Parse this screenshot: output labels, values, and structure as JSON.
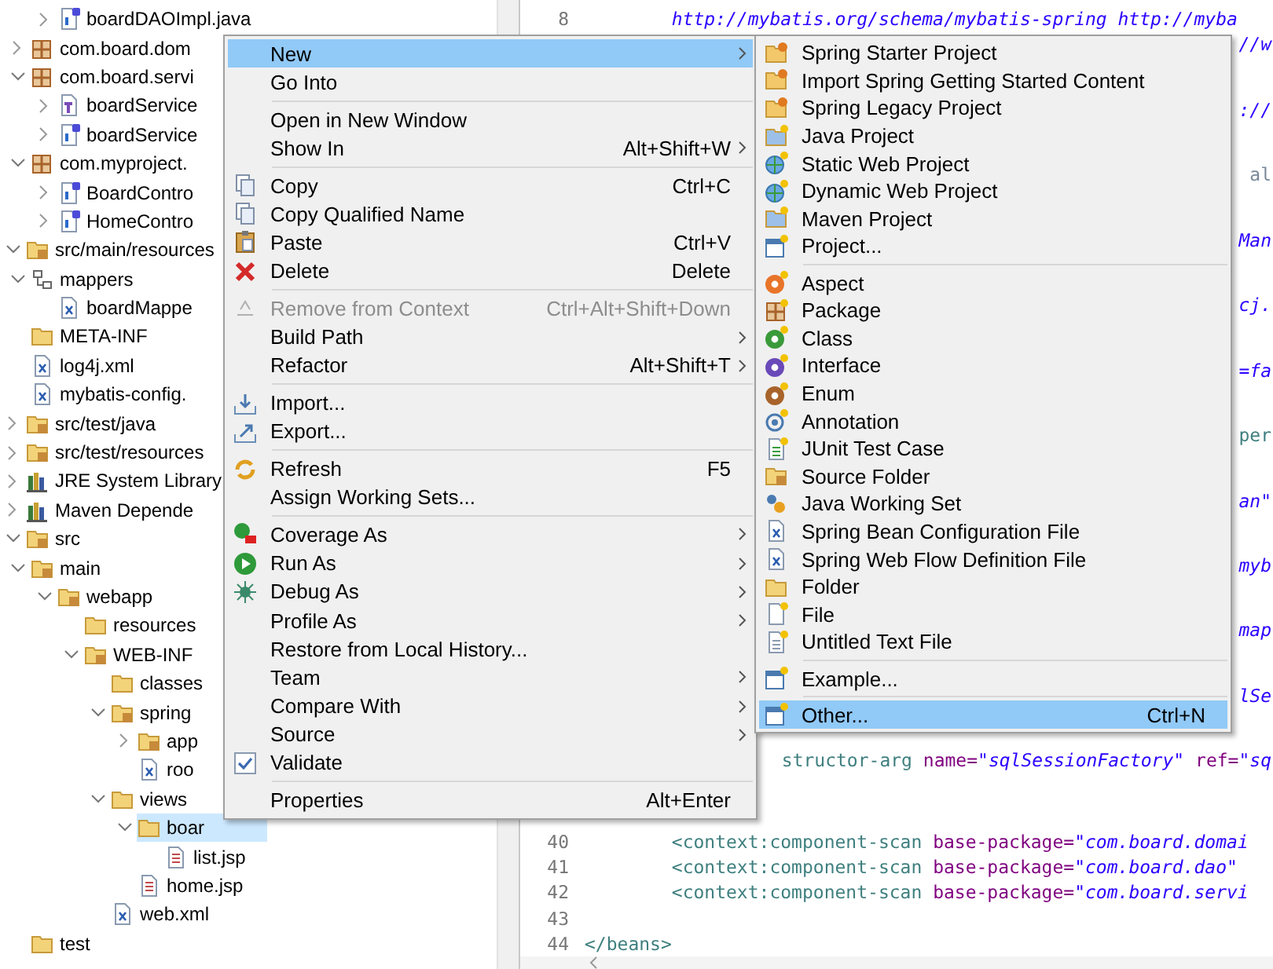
{
  "explorer": {
    "items": [
      {
        "children": [
          {
            "children": [
              {
                "label": "boardDAOImpl.java",
                "kind": "class",
                "expanded": false,
                "selected": false
              }
            ]
          },
          {
            "label": "com.board.dom",
            "kind": "package",
            "expanded": false,
            "selected": false
          },
          {
            "label": "com.board.servi",
            "kind": "package",
            "expanded": true,
            "selected": false,
            "children": [
              {
                "label": "boardService",
                "kind": "interface",
                "expanded": false,
                "selected": false
              },
              {
                "label": "boardService",
                "kind": "class",
                "expanded": false,
                "selected": false
              }
            ]
          },
          {
            "label": "com.myproject.",
            "kind": "package",
            "expanded": true,
            "selected": false,
            "children": [
              {
                "label": "BoardContro",
                "kind": "class",
                "expanded": false,
                "selected": false
              },
              {
                "label": "HomeContro",
                "kind": "class",
                "expanded": false,
                "selected": false
              }
            ]
          }
        ]
      },
      {
        "label": "src/main/resources",
        "kind": "source-folder",
        "expanded": true,
        "selected": false,
        "children": [
          {
            "label": "mappers",
            "kind": "hierarchy",
            "expanded": true,
            "selected": false,
            "children": [
              {
                "label": "boardMappe",
                "kind": "xml",
                "selected": false
              }
            ]
          },
          {
            "label": "META-INF",
            "kind": "folder",
            "selected": false
          },
          {
            "label": "log4j.xml",
            "kind": "xml",
            "selected": false
          },
          {
            "label": "mybatis-config.",
            "kind": "xml",
            "selected": false
          }
        ]
      },
      {
        "label": "src/test/java",
        "kind": "source-folder",
        "expanded": false,
        "selected": false
      },
      {
        "label": "src/test/resources",
        "kind": "source-folder",
        "expanded": false,
        "selected": false
      },
      {
        "label": "JRE System Library",
        "kind": "library",
        "expanded": false,
        "selected": false
      },
      {
        "label": "Maven Depende",
        "kind": "library",
        "expanded": false,
        "selected": false
      },
      {
        "label": "src",
        "kind": "source-folder",
        "expanded": true,
        "selected": false,
        "children": [
          {
            "label": "main",
            "kind": "source-folder",
            "expanded": true,
            "selected": false,
            "children": [
              {
                "label": "webapp",
                "kind": "source-folder",
                "expanded": true,
                "selected": false,
                "children": [
                  {
                    "label": "resources",
                    "kind": "folder",
                    "selected": false
                  },
                  {
                    "label": "WEB-INF",
                    "kind": "source-folder",
                    "expanded": true,
                    "selected": false,
                    "children": [
                      {
                        "label": "classes",
                        "kind": "folder",
                        "selected": false
                      },
                      {
                        "label": "spring",
                        "kind": "source-folder",
                        "expanded": true,
                        "selected": false,
                        "children": [
                          {
                            "label": "app",
                            "kind": "source-folder",
                            "expanded": false,
                            "selected": false
                          },
                          {
                            "label": "roo",
                            "kind": "xml",
                            "selected": false
                          }
                        ]
                      },
                      {
                        "label": "views",
                        "kind": "folder",
                        "expanded": true,
                        "selected": false,
                        "children": [
                          {
                            "label": "boar",
                            "kind": "folder",
                            "expanded": true,
                            "selected": true,
                            "children": [
                              {
                                "label": "list.jsp",
                                "kind": "jsp",
                                "selected": false
                              }
                            ]
                          },
                          {
                            "label": "home.jsp",
                            "kind": "jsp",
                            "selected": false
                          }
                        ]
                      },
                      {
                        "label": "web.xml",
                        "kind": "xml",
                        "selected": false
                      }
                    ]
                  }
                ]
              }
            ]
          },
          {
            "label": "test",
            "kind": "folder",
            "selected": false
          }
        ]
      }
    ]
  },
  "editor": {
    "lines": [
      {
        "number": "8",
        "tokens": [
          {
            "kind": "value",
            "text": "\t\thttp://mybatis.org/schema/mybatis-spring http://myba"
          }
        ]
      },
      {
        "tokens": [
          {
            "kind": "value",
            "text": "//w"
          }
        ]
      },
      {
        "tokens": [
          {
            "kind": "value",
            "text": "://"
          }
        ]
      },
      {
        "tokens": [
          {
            "kind": "plain",
            "text": "al"
          }
        ]
      },
      {
        "tokens": [
          {
            "kind": "value",
            "text": "Man"
          }
        ]
      },
      {
        "tokens": [
          {
            "kind": "value",
            "text": "cj."
          }
        ]
      },
      {
        "tokens": [
          {
            "kind": "value",
            "text": "=fa"
          }
        ]
      },
      {
        "tokens": [
          {
            "kind": "tag",
            "text": "per"
          }
        ]
      },
      {
        "tokens": [
          {
            "kind": "value",
            "text": "an\""
          }
        ]
      },
      {
        "tokens": [
          {
            "kind": "value",
            "text": "myb"
          }
        ]
      },
      {
        "tokens": [
          {
            "kind": "value",
            "text": "map"
          }
        ]
      },
      {
        "tokens": [
          {
            "kind": "value",
            "text": "lSe"
          }
        ]
      },
      {
        "tokens": [
          {
            "kind": "tag",
            "text": "structor-arg "
          },
          {
            "kind": "attr",
            "text": "name="
          },
          {
            "kind": "value",
            "text": "\"sqlSessionFactory\" "
          },
          {
            "kind": "attr",
            "text": "ref="
          },
          {
            "kind": "value",
            "text": "\"sq"
          }
        ]
      },
      {
        "number": "40",
        "tokens": [
          {
            "kind": "tag",
            "text": "\t\t<context:component-scan "
          },
          {
            "kind": "attr",
            "text": "base-package="
          },
          {
            "kind": "value",
            "text": "\"com.board.domai"
          }
        ]
      },
      {
        "number": "41",
        "tokens": [
          {
            "kind": "tag",
            "text": "\t\t<context:component-scan "
          },
          {
            "kind": "attr",
            "text": "base-package="
          },
          {
            "kind": "value",
            "text": "\"com.board.dao\""
          }
        ]
      },
      {
        "number": "42",
        "tokens": [
          {
            "kind": "tag",
            "text": "\t\t<context:component-scan "
          },
          {
            "kind": "attr",
            "text": "base-package="
          },
          {
            "kind": "value",
            "text": "\"com.board.servi"
          }
        ]
      },
      {
        "number": "43"
      },
      {
        "number": "44",
        "tokens": [
          {
            "kind": "tag",
            "text": "</beans>"
          }
        ]
      }
    ]
  },
  "context_menu": {
    "items": [
      {
        "kind": "item",
        "label": "New",
        "submenu": true,
        "selected": true,
        "disabled": false
      },
      {
        "kind": "item",
        "label": "Go Into",
        "submenu": false,
        "selected": false,
        "disabled": false
      },
      {
        "kind": "separator"
      },
      {
        "kind": "item",
        "label": "Open in New Window",
        "submenu": false,
        "selected": false,
        "disabled": false
      },
      {
        "kind": "item",
        "label": "Show In",
        "shortcut": "Alt+Shift+W",
        "submenu": true,
        "selected": false,
        "disabled": false
      },
      {
        "kind": "separator"
      },
      {
        "kind": "item",
        "label": "Copy",
        "shortcut": "Ctrl+C",
        "submenu": false,
        "selected": false,
        "disabled": false
      },
      {
        "kind": "item",
        "label": "Copy Qualified Name",
        "submenu": false,
        "selected": false,
        "disabled": false
      },
      {
        "kind": "item",
        "label": "Paste",
        "shortcut": "Ctrl+V",
        "submenu": false,
        "selected": false,
        "disabled": false
      },
      {
        "kind": "item",
        "label": "Delete",
        "shortcut": "Delete",
        "submenu": false,
        "selected": false,
        "disabled": false
      },
      {
        "kind": "separator"
      },
      {
        "kind": "item",
        "label": "Remove from Context",
        "shortcut": "Ctrl+Alt+Shift+Down",
        "submenu": false,
        "selected": false,
        "disabled": true
      },
      {
        "kind": "item",
        "label": "Build Path",
        "submenu": true,
        "selected": false,
        "disabled": false
      },
      {
        "kind": "item",
        "label": "Refactor",
        "shortcut": "Alt+Shift+T",
        "submenu": true,
        "selected": false,
        "disabled": false
      },
      {
        "kind": "separator"
      },
      {
        "kind": "item",
        "label": "Import...",
        "submenu": false,
        "selected": false,
        "disabled": false
      },
      {
        "kind": "item",
        "label": "Export...",
        "submenu": false,
        "selected": false,
        "disabled": false
      },
      {
        "kind": "separator"
      },
      {
        "kind": "item",
        "label": "Refresh",
        "shortcut": "F5",
        "submenu": false,
        "selected": false,
        "disabled": false
      },
      {
        "kind": "item",
        "label": "Assign Working Sets...",
        "submenu": false,
        "selected": false,
        "disabled": false
      },
      {
        "kind": "separator"
      },
      {
        "kind": "item",
        "label": "Coverage As",
        "submenu": true,
        "selected": false,
        "disabled": false
      },
      {
        "kind": "item",
        "label": "Run As",
        "submenu": true,
        "selected": false,
        "disabled": false
      },
      {
        "kind": "item",
        "label": "Debug As",
        "submenu": true,
        "selected": false,
        "disabled": false
      },
      {
        "kind": "item",
        "label": "Profile As",
        "submenu": true,
        "selected": false,
        "disabled": false
      },
      {
        "kind": "item",
        "label": "Restore from Local History...",
        "submenu": false,
        "selected": false,
        "disabled": false
      },
      {
        "kind": "item",
        "label": "Team",
        "submenu": true,
        "selected": false,
        "disabled": false
      },
      {
        "kind": "item",
        "label": "Compare With",
        "submenu": true,
        "selected": false,
        "disabled": false
      },
      {
        "kind": "item",
        "label": "Source",
        "submenu": true,
        "selected": false,
        "disabled": false
      },
      {
        "kind": "item",
        "label": "Validate",
        "submenu": false,
        "selected": false,
        "disabled": false
      },
      {
        "kind": "separator"
      },
      {
        "kind": "item",
        "label": "Properties",
        "shortcut": "Alt+Enter",
        "submenu": false,
        "selected": false,
        "disabled": false
      }
    ]
  },
  "submenu": {
    "items": [
      {
        "kind": "item",
        "label": "Spring Starter Project",
        "selected": false
      },
      {
        "kind": "item",
        "label": "Import Spring Getting Started Content",
        "selected": false
      },
      {
        "kind": "item",
        "label": "Spring Legacy Project",
        "selected": false
      },
      {
        "kind": "item",
        "label": "Java Project",
        "selected": false
      },
      {
        "kind": "item",
        "label": "Static Web Project",
        "selected": false
      },
      {
        "kind": "item",
        "label": "Dynamic Web Project",
        "selected": false
      },
      {
        "kind": "item",
        "label": "Maven Project",
        "selected": false
      },
      {
        "kind": "item",
        "label": "Project...",
        "selected": false
      },
      {
        "kind": "separator"
      },
      {
        "kind": "item",
        "label": "Aspect",
        "selected": false
      },
      {
        "kind": "item",
        "label": "Package",
        "selected": false
      },
      {
        "kind": "item",
        "label": "Class",
        "selected": false
      },
      {
        "kind": "item",
        "label": "Interface",
        "selected": false
      },
      {
        "kind": "item",
        "label": "Enum",
        "selected": false
      },
      {
        "kind": "item",
        "label": "Annotation",
        "selected": false
      },
      {
        "kind": "item",
        "label": "JUnit Test Case",
        "selected": false
      },
      {
        "kind": "item",
        "label": "Source Folder",
        "selected": false
      },
      {
        "kind": "item",
        "label": "Java Working Set",
        "selected": false
      },
      {
        "kind": "item",
        "label": "Spring Bean Configuration File",
        "selected": false
      },
      {
        "kind": "item",
        "label": "Spring Web Flow Definition File",
        "selected": false
      },
      {
        "kind": "item",
        "label": "Folder",
        "selected": false
      },
      {
        "kind": "item",
        "label": "File",
        "selected": false
      },
      {
        "kind": "item",
        "label": "Untitled Text File",
        "selected": false
      },
      {
        "kind": "separator"
      },
      {
        "kind": "item",
        "label": "Example...",
        "selected": false
      },
      {
        "kind": "separator"
      },
      {
        "kind": "item",
        "label": "Other...",
        "shortcut": "Ctrl+N",
        "selected": true
      }
    ]
  }
}
